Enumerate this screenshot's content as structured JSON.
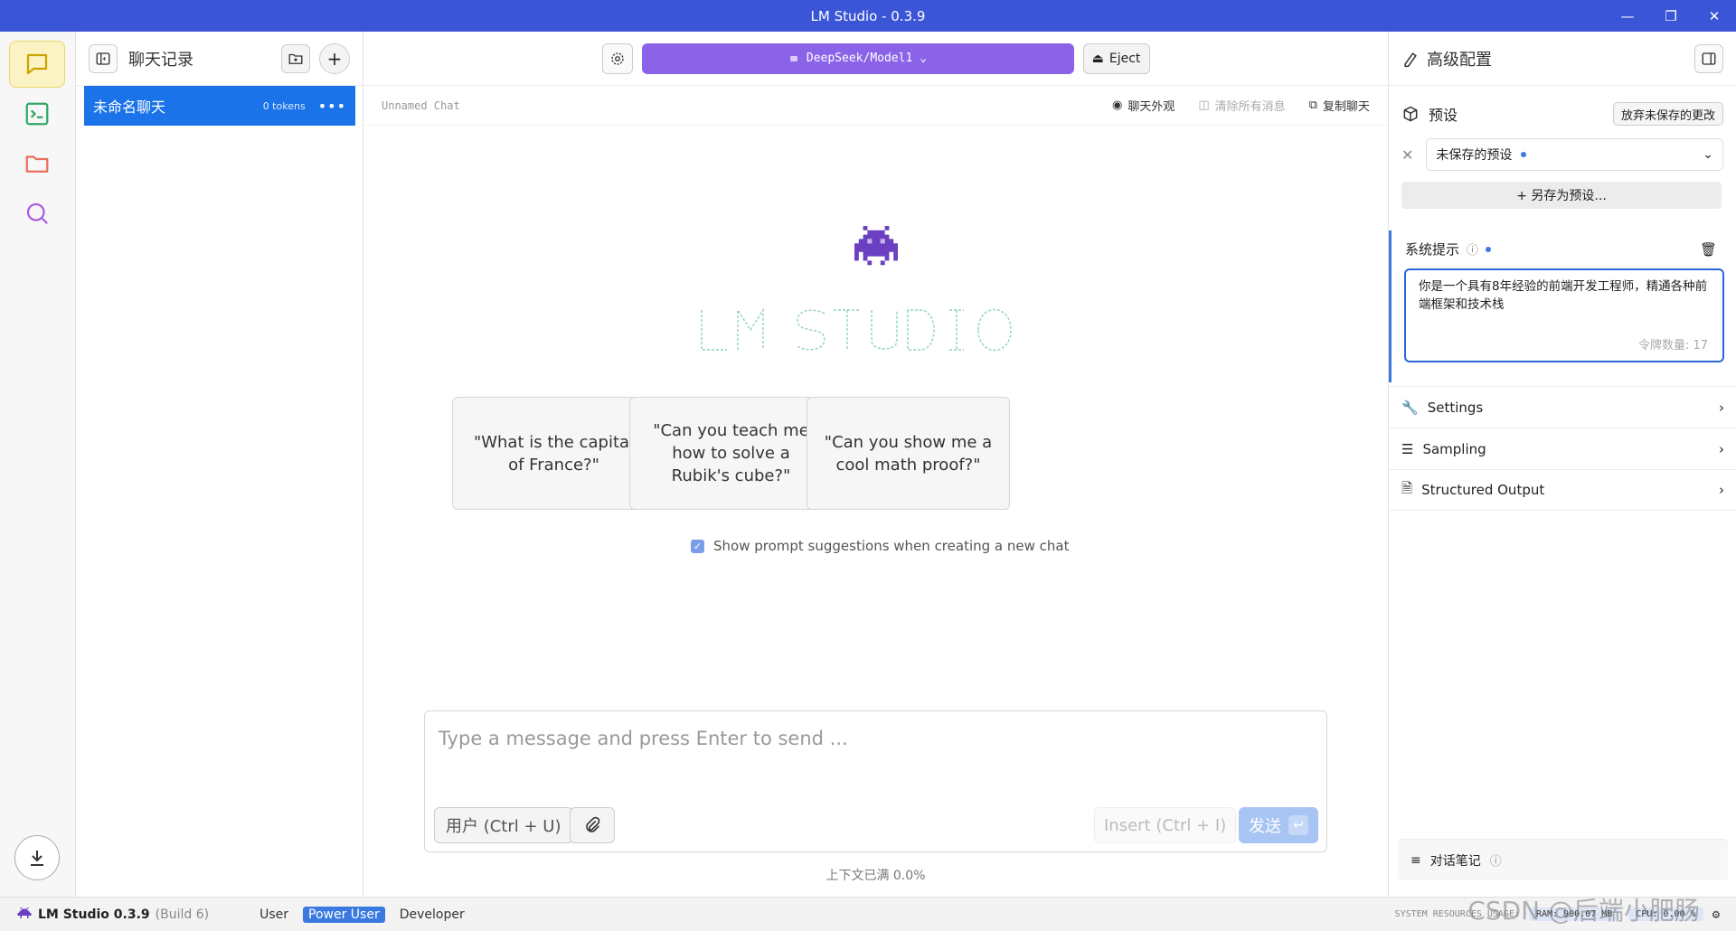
{
  "window": {
    "title": "LM Studio - 0.3.9"
  },
  "chatlist": {
    "title": "聊天记录",
    "items": [
      {
        "name": "未命名聊天",
        "tokens": "0 tokens"
      }
    ]
  },
  "topbar": {
    "model_label": "DeepSeek/Model1",
    "eject_label": "Eject"
  },
  "subbar": {
    "chat_name": "Unnamed Chat",
    "appearance": "聊天外观",
    "clear_all": "清除所有消息",
    "copy_chat": "复制聊天"
  },
  "suggestions": [
    "\"What is the capital of France?\"",
    "\"Can you teach me how to solve a Rubik's cube?\"",
    "\"Can you show me a cool math proof?\""
  ],
  "suggestion_toggle": {
    "label": "Show prompt suggestions when creating a new chat",
    "checked": true
  },
  "composer": {
    "placeholder": "Type a message and press Enter to send ...",
    "role_label": "用户 (Ctrl + U)",
    "insert_label": "Insert (Ctrl + I)",
    "send_label": "发送"
  },
  "context_status": "上下文已满 0.0%",
  "right": {
    "title": "高级配置",
    "preset_label": "预设",
    "discard_label": "放弃未保存的更改",
    "preset_value": "未保存的预设",
    "save_as_label": "+ 另存为预设...",
    "system_prompt_label": "系统提示",
    "system_prompt_text": "你是一个具有8年经验的前端开发工程师，精通各种前端框架和技术栈",
    "token_count": "令牌数量: 17",
    "sections": [
      "Settings",
      "Sampling",
      "Structured Output"
    ],
    "notes_label": "对话笔记"
  },
  "statusbar": {
    "brand": "LM Studio 0.3.9",
    "build": "(Build 6)",
    "modes": [
      "User",
      "Power User",
      "Developer"
    ],
    "active_mode": "Power User",
    "resources_label": "SYSTEM RESOURCES USAGE:",
    "ram": "RAM: 900.07 MB",
    "cpu": "CPU: 0.00 %"
  },
  "watermark": "CSDN @后端小肥肠",
  "colors": {
    "titlebar": "#3a55d6",
    "model_button": "#8b63e8",
    "selected_chat": "#1a73e8",
    "accent": "#3a7ae0"
  }
}
